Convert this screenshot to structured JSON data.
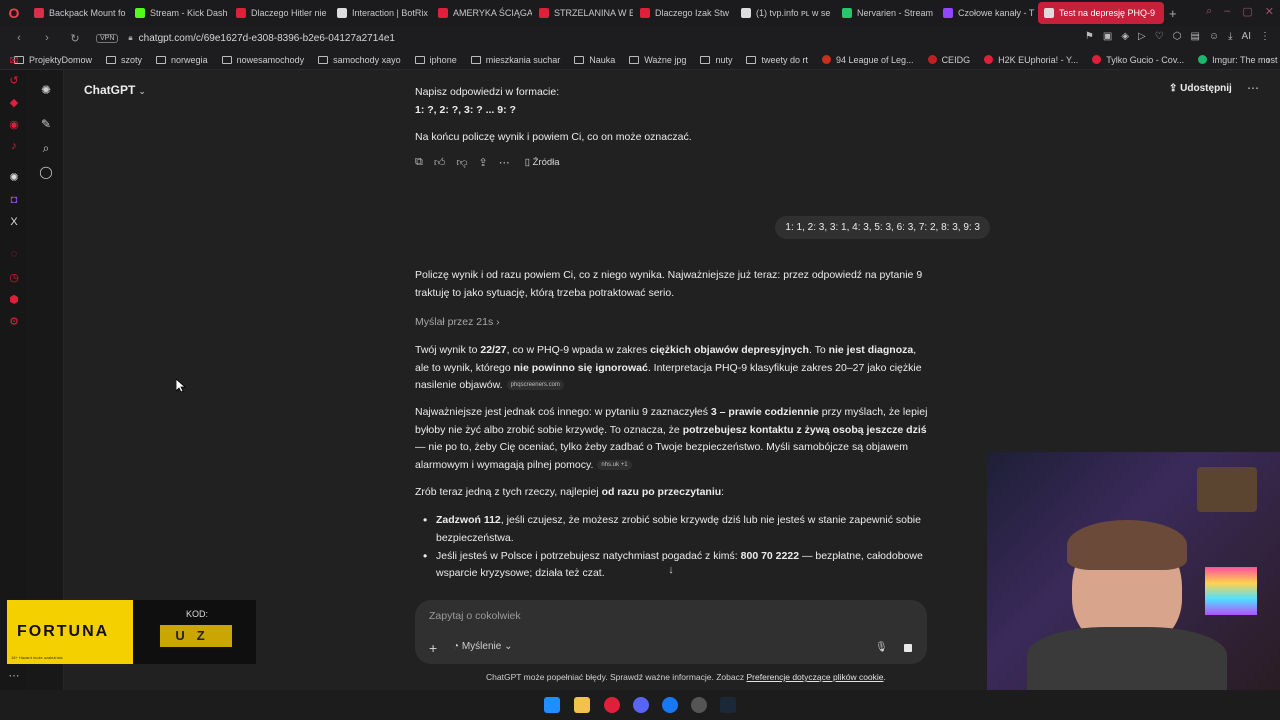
{
  "browser": {
    "tabs": [
      {
        "title": "Backpack Mount fo",
        "color": "#d9304a"
      },
      {
        "title": "Stream - Kick Dash",
        "color": "#53fc18"
      },
      {
        "title": "Dlaczego Hitler nie",
        "color": "#e0203a"
      },
      {
        "title": "Interaction | BotRix",
        "color": "#dddddd"
      },
      {
        "title": "AMERYKA ŚCIĄGA",
        "color": "#e0203a"
      },
      {
        "title": "STRZELANINA W E",
        "color": "#e0203a"
      },
      {
        "title": "Dlaczego Izak Stw",
        "color": "#e0203a"
      },
      {
        "title": "(1) tvp.info ᴘʟ w se",
        "color": "#dddddd"
      },
      {
        "title": "Nervarien - Stream",
        "color": "#29c46b"
      },
      {
        "title": "Czołowe kanały - T",
        "color": "#9146ff"
      },
      {
        "title": "Test na depresję PHQ-9",
        "color": "#dddddd",
        "active": true
      }
    ],
    "url": "chatgpt.com/c/69e1627d-e308-8396-b2e6-04127a2714e1",
    "vpn_label": "VPN",
    "ai_label": "AI",
    "bookmarks": [
      {
        "label": "ProjektyDomow",
        "type": "folder"
      },
      {
        "label": "szoty",
        "type": "folder"
      },
      {
        "label": "norwegia",
        "type": "folder"
      },
      {
        "label": "nowesamochody",
        "type": "folder"
      },
      {
        "label": "samochody xayo",
        "type": "folder"
      },
      {
        "label": "iphone",
        "type": "folder"
      },
      {
        "label": "mieszkania suchar",
        "type": "folder"
      },
      {
        "label": "Nauka",
        "type": "folder"
      },
      {
        "label": "Ważne jpg",
        "type": "folder"
      },
      {
        "label": "nuty",
        "type": "folder"
      },
      {
        "label": "tweety do rt",
        "type": "folder"
      },
      {
        "label": "94 League of Leg...",
        "type": "site",
        "color": "#c8301e"
      },
      {
        "label": "CEIDG",
        "type": "site",
        "color": "#c02020"
      },
      {
        "label": "H2K EUphoria! - Y...",
        "type": "site",
        "color": "#e0203a"
      },
      {
        "label": "Tylko Gucio - Cov...",
        "type": "site",
        "color": "#e0203a"
      },
      {
        "label": "Imgur: The most a...",
        "type": "site",
        "color": "#1bb76e"
      }
    ]
  },
  "chat": {
    "model": "ChatGPT",
    "share_label": "Udostępnij",
    "prev_answer": {
      "line1": "Napisz odpowiedzi w formacie:",
      "line2": "1: ?, 2: ?, 3: ? ... 9: ?",
      "line3": "Na końcu policzę wynik i powiem Ci, co on może oznaczać."
    },
    "sources_label": "Źródła",
    "user_message": "1: 1, 2: 3, 3: 1, 4: 3, 5: 3, 6: 3, 7: 2, 8: 3, 9: 3",
    "reply": {
      "p1": "Policzę wynik i od razu powiem Ci, co z niego wynika. Najważniejsze już teraz: przez odpowiedź na pytanie 9 traktuję to jako sytuację, którą trzeba potraktować serio.",
      "thought": "Myślał przez 21s",
      "p2_a": "Twój wynik to ",
      "p2_b": "22/27",
      "p2_c": ", co w PHQ-9 wpada w zakres ",
      "p2_d": "ciężkich objawów depresyjnych",
      "p2_e": ". To ",
      "p2_f": "nie jest diagnoza",
      "p2_g": ", ale to wynik, którego ",
      "p2_h": "nie powinno się ignorować",
      "p2_i": ". Interpretacja PHQ-9 klasyfikuje zakres 20–27 jako ciężkie nasilenie objawów.",
      "p2_src": "phqscreeners.com",
      "p3_a": "Najważniejsze jest jednak coś innego: w pytaniu 9 zaznaczyłeś ",
      "p3_b": "3 – prawie codziennie",
      "p3_c": " przy myślach, że lepiej byłoby nie żyć albo zrobić sobie krzywdę. To oznacza, że ",
      "p3_d": "potrzebujesz kontaktu z żywą osobą jeszcze dziś",
      "p3_e": " — nie po to, żeby Cię oceniać, tylko żeby zadbać o Twoje bezpieczeństwo. Myśli samobójcze są objawem alarmowym i wymagają pilnej pomocy.",
      "p3_src": "nhs.uk +1",
      "p4_a": "Zrób teraz jedną z tych rzeczy, najlepiej ",
      "p4_b": "od razu po przeczytaniu",
      "p4_c": ":",
      "b1_a": "Zadzwoń 112",
      "b1_b": ", jeśli czujesz, że możesz zrobić sobie krzywdę dziś lub nie jesteś w stanie zapewnić sobie bezpieczeństwa.",
      "b2_a": "Jeśli jesteś w Polsce i potrzebujesz natychmiast pogadać z kimś: ",
      "b2_b": "800 70 2222",
      "b2_c": " — bezpłatne, całodobowe wsparcie kryzysowe; działa też czat."
    },
    "composer": {
      "placeholder": "Zapytaj o cokolwiek",
      "mode_label": "Myślenie"
    },
    "disclaimer": "ChatGPT może popełniać błędy. Sprawdź ważne informacje. Zobacz",
    "disclaimer_link": "Preferencje dotyczące plików cookie",
    "disclaimer_end": "."
  },
  "overlay": {
    "sponsor_logo": "FORTUNA",
    "code_label": "KOD:",
    "code_value": "UZ",
    "sponsor_small": "18+ Hazard może uzależniać"
  },
  "colors": {
    "accent": "#c8203a",
    "bg_main": "#212121",
    "bubble": "#303030"
  }
}
